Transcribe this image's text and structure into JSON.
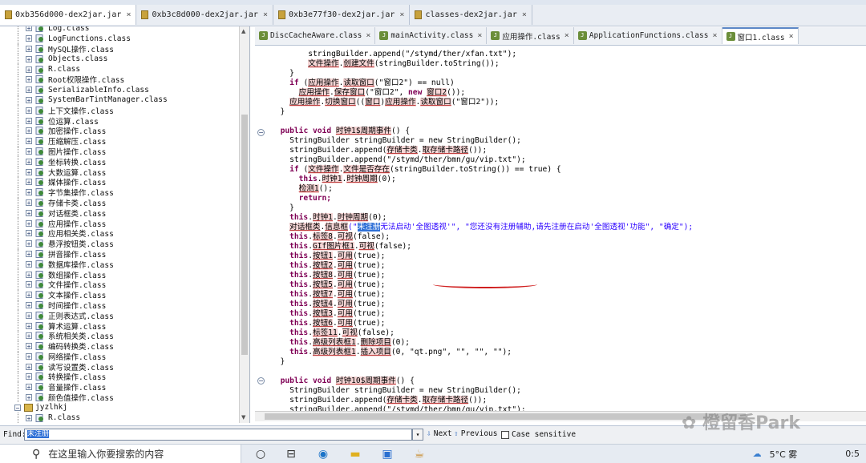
{
  "top_tabs": [
    {
      "label": "0xb356d000-dex2jar.jar",
      "active": true
    },
    {
      "label": "0xb3c8d000-dex2jar.jar",
      "active": false
    },
    {
      "label": "0xb3e77f30-dex2jar.jar",
      "active": false
    },
    {
      "label": "classes-dex2jar.jar",
      "active": false
    }
  ],
  "tree": {
    "items": [
      "Log.class",
      "LogFunctions.class",
      "MySQL操作.class",
      "Objects.class",
      "R.class",
      "Root权限操作.class",
      "SerializableInfo.class",
      "SystemBarTintManager.class",
      "上下文操作.class",
      "位运算.class",
      "加密操作.class",
      "压缩解压.class",
      "图片操作.class",
      "坐标转换.class",
      "大数运算.class",
      "媒体操作.class",
      "字节集操作.class",
      "存储卡类.class",
      "对话框类.class",
      "应用操作.class",
      "应用相关类.class",
      "悬浮按钮类.class",
      "拼音操作.class",
      "数据库操作.class",
      "数组操作.class",
      "文件操作.class",
      "文本操作.class",
      "时间操作.class",
      "正则表达式.class",
      "算术运算.class",
      "系统相关类.class",
      "编码转换类.class",
      "网络操作.class",
      "读写设置类.class",
      "转换操作.class",
      "音量操作.class",
      "颜色值操作.class"
    ],
    "package_label": "jyzlhkj",
    "sub_item": "R.class"
  },
  "editor_tabs": [
    {
      "label": "DiscCacheAware.class",
      "active": false
    },
    {
      "label": "mainActivity.class",
      "active": false
    },
    {
      "label": "应用操作.class",
      "active": false
    },
    {
      "label": "ApplicationFunctions.class",
      "active": false
    },
    {
      "label": "窗口1.class",
      "active": true
    }
  ],
  "code": {
    "l01": "        stringBuilder.append(\"/stymd/ther/xfan.txt\");",
    "l02a": "文件操作",
    "l02b": "创建文件",
    "l02c": "(stringBuilder.toString());",
    "l03": "    }",
    "l04a": "应用操作",
    "l04b": "读取窗口",
    "l04c": "(\"窗口2\") == null)",
    "l05a": "应用操作",
    "l05b": "保存窗口",
    "l05c": "(\"窗口2\", ",
    "l05d": "窗口2",
    "l05e": "());",
    "l06a": "应用操作",
    "l06b": "切换窗口",
    "l06c": "((",
    "l06d": "窗口",
    "l06e": ")",
    "l06f": "应用操作",
    "l06g": "读取窗口",
    "l06h": "(\"窗口2\"));",
    "l07": "  }",
    "l08a": "public void ",
    "l08b": "时钟1$周期事件",
    "l08c": "() {",
    "l09": "    StringBuilder stringBuilder = new StringBuilder();",
    "l10a": "    stringBuilder.append(",
    "l10b": "存储卡类",
    "l10c": "取存储卡路径",
    "l10d": "());",
    "l11": "    stringBuilder.append(\"/stymd/ther/bmn/gu/vip.txt\");",
    "l12a": "文件操作",
    "l12b": "文件是否存在",
    "l12c": "(stringBuilder.toString()) == true) {",
    "l13a": "时钟1",
    "l13b": "时钟周期",
    "l13c": "(0);",
    "l14a": "检测1",
    "l14b": "();",
    "l15": "      return;",
    "l16": "    }",
    "l17a": "时钟1",
    "l17b": "时钟周期",
    "l17c": "(0);",
    "l18a": "对话框类",
    "l18b": "信息框",
    "l18c": "(\"",
    "l18d": "未注册",
    "l18e": "无法启动'全图透视'\", \"您还没有注册辅助,请先注册在启动'全图透视'功能\", \"确定\");",
    "l19a": "标签8",
    "l19b": "可视",
    "l19c": "(false);",
    "l20a": "GIf图片框1",
    "l20b": "可视",
    "l20c": "(false);",
    "btn_lines": [
      {
        "obj": "按钮1",
        "m": "可用",
        "v": "(true);"
      },
      {
        "obj": "按钮2",
        "m": "可用",
        "v": "(true);"
      },
      {
        "obj": "按钮8",
        "m": "可用",
        "v": "(true);"
      },
      {
        "obj": "按钮5",
        "m": "可用",
        "v": "(true);"
      },
      {
        "obj": "按钮7",
        "m": "可用",
        "v": "(true);"
      },
      {
        "obj": "按钮4",
        "m": "可用",
        "v": "(true);"
      },
      {
        "obj": "按钮3",
        "m": "可用",
        "v": "(true);"
      },
      {
        "obj": "按钮6",
        "m": "可用",
        "v": "(true);"
      }
    ],
    "l29a": "标签11",
    "l29b": "可视",
    "l29c": "(false);",
    "l30a": "高级列表框1",
    "l30b": "删除项目",
    "l30c": "(0);",
    "l31a": "高级列表框1",
    "l31b": "插入项目",
    "l31c": "(0, \"qt.png\", \"\", \"\", \"\");",
    "l32": "  }",
    "l33a": "public void ",
    "l33b": "时钟10$周期事件",
    "l33c": "() {",
    "l34": "    StringBuilder stringBuilder = new StringBuilder();",
    "l35a": "    stringBuilder.append(",
    "l35b": "存储卡类",
    "l35c": "取存储卡路径",
    "l35d": "());",
    "l36": "    stringBuilder.append(\"/stymd/ther/bmn/gu/vip.txt\");"
  },
  "find": {
    "label": "Find:",
    "value": "未注册",
    "next_label": "Next",
    "previous_label": "Previous",
    "case_label": "Case sensitive"
  },
  "taskbar": {
    "search_placeholder": "在这里输入你要搜索的内容",
    "weather": "5°C 雾",
    "time": "0:5"
  },
  "watermark": "橙留香Park"
}
